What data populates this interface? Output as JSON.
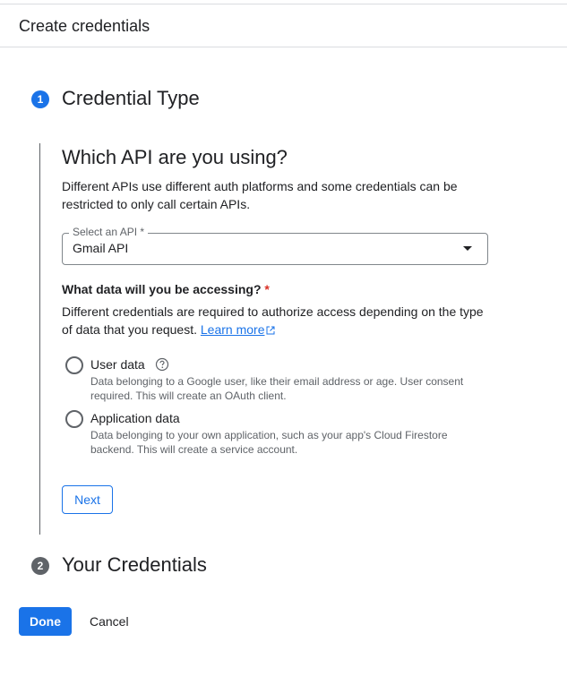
{
  "header": {
    "title": "Create credentials"
  },
  "steps": [
    {
      "number": "1",
      "title": "Credential Type"
    },
    {
      "number": "2",
      "title": "Your Credentials"
    }
  ],
  "api_section": {
    "title": "Which API are you using?",
    "description": "Different APIs use different auth platforms and some credentials can be restricted to only call certain APIs."
  },
  "api_select": {
    "label": "Select an API *",
    "value": "Gmail API"
  },
  "data_question": {
    "title": "What data will you be accessing?",
    "required_mark": "*",
    "description": "Different credentials are required to authorize access depending on the type of data that you request.",
    "learn_more": "Learn more"
  },
  "options": [
    {
      "label": "User data",
      "description": "Data belonging to a Google user, like their email address or age. User consent required. This will create an OAuth client."
    },
    {
      "label": "Application data",
      "description": "Data belonging to your own application, such as your app's Cloud Firestore backend. This will create a service account."
    }
  ],
  "buttons": {
    "next": "Next",
    "done": "Done",
    "cancel": "Cancel"
  },
  "colors": {
    "accent": "#1a73e8",
    "required": "#d93025",
    "inactive_step": "#5f6368"
  },
  "icons": {
    "help": "help-circle-icon",
    "external": "open-in-new-icon",
    "dropdown": "caret-down-icon"
  }
}
